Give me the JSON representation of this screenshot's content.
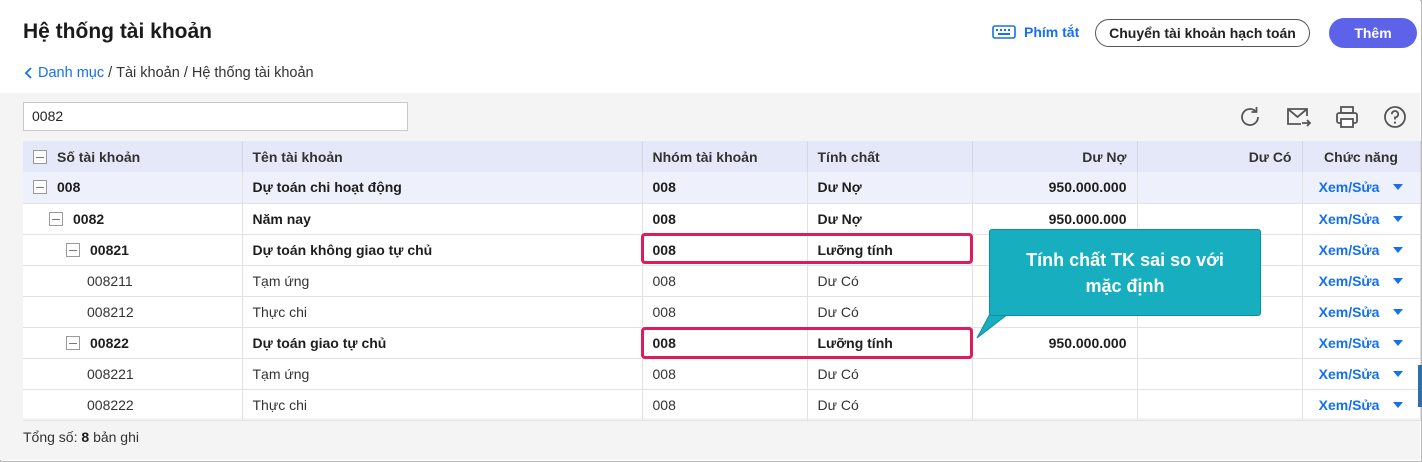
{
  "header": {
    "title": "Hệ thống tài khoản",
    "shortcut_label": "Phím tắt",
    "transfer_button": "Chuyển tài khoản hạch toán",
    "add_button": "Thêm"
  },
  "breadcrumb": {
    "back": "Danh mục",
    "sep1": "/",
    "level2": "Tài khoản",
    "sep2": "/",
    "current": "Hệ thống tài khoản"
  },
  "search": {
    "value": "0082"
  },
  "toolbar": {
    "icons": [
      "refresh-icon",
      "mail-export-icon",
      "print-icon",
      "help-icon"
    ]
  },
  "table": {
    "columns": {
      "code": "Số tài khoản",
      "name": "Tên tài khoản",
      "group": "Nhóm tài khoản",
      "nature": "Tính chất",
      "debit": "Dư Nợ",
      "credit": "Dư Có",
      "actions": "Chức năng"
    },
    "rows": [
      {
        "code": "008",
        "name": "Dự toán chi hoạt động",
        "group": "008",
        "nature": "Dư Nợ",
        "debit": "950.000.000",
        "credit": "",
        "action": "Xem/Sửa"
      },
      {
        "code": "0082",
        "name": "Năm nay",
        "group": "008",
        "nature": "Dư Nợ",
        "debit": "950.000.000",
        "credit": "",
        "action": "Xem/Sửa"
      },
      {
        "code": "00821",
        "name": "Dự toán không giao tự chủ",
        "group": "008",
        "nature": "Lưỡng tính",
        "debit": "",
        "credit": "",
        "action": "Xem/Sửa"
      },
      {
        "code": "008211",
        "name": "Tạm ứng",
        "group": "008",
        "nature": "Dư Có",
        "debit": "",
        "credit": "",
        "action": "Xem/Sửa"
      },
      {
        "code": "008212",
        "name": "Thực chi",
        "group": "008",
        "nature": "Dư Có",
        "debit": "",
        "credit": "",
        "action": "Xem/Sửa"
      },
      {
        "code": "00822",
        "name": "Dự toán giao tự chủ",
        "group": "008",
        "nature": "Lưỡng tính",
        "debit": "950.000.000",
        "credit": "",
        "action": "Xem/Sửa"
      },
      {
        "code": "008221",
        "name": "Tạm ứng",
        "group": "008",
        "nature": "Dư Có",
        "debit": "",
        "credit": "",
        "action": "Xem/Sửa"
      },
      {
        "code": "008222",
        "name": "Thực chi",
        "group": "008",
        "nature": "Dư Có",
        "debit": "",
        "credit": "",
        "action": "Xem/Sửa"
      }
    ]
  },
  "annotation": {
    "text": "Tính chất TK sai so với mặc định",
    "color": "#17aebf",
    "highlight_color": "#e01b5a"
  },
  "footer": {
    "label": "Tổng số:",
    "count": "8",
    "suffix": "bản ghi"
  },
  "colors": {
    "accent": "#1570ef",
    "primary_button": "#5d63e8",
    "header_row": "#e5e8f8"
  }
}
